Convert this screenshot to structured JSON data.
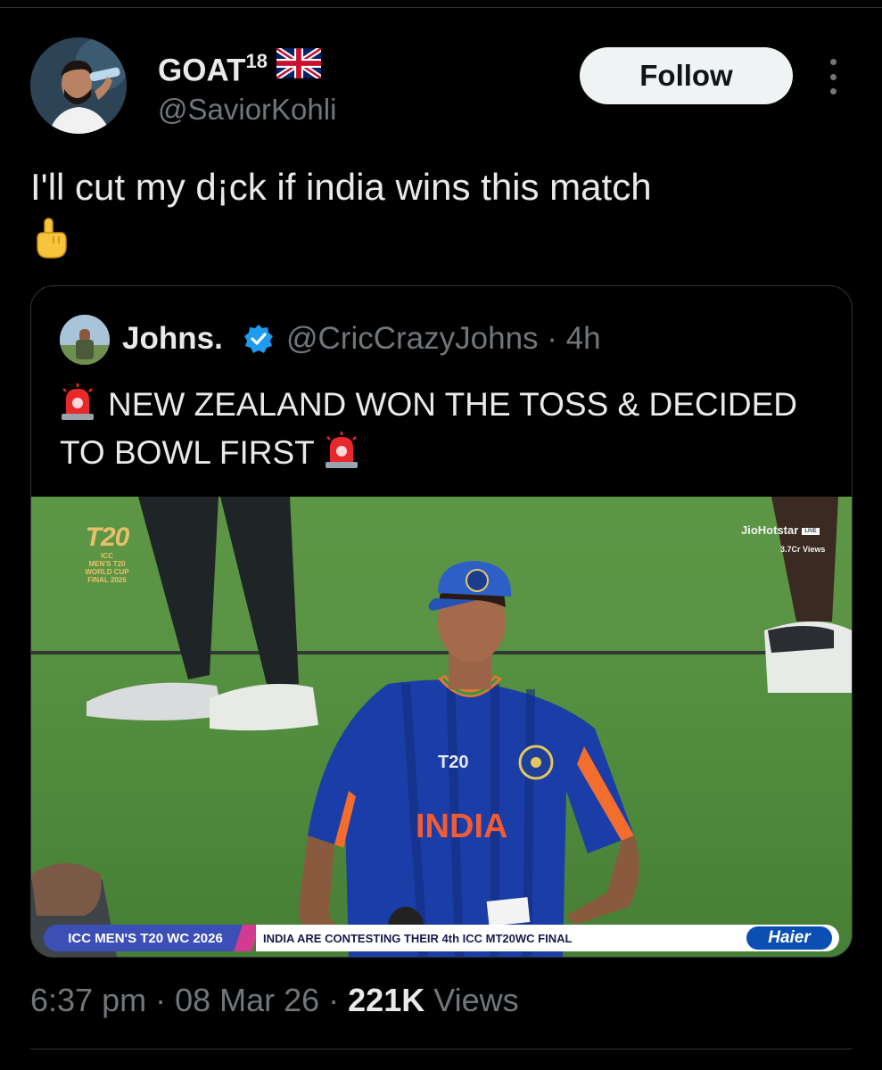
{
  "author": {
    "name": "GOAT",
    "name_superscript": "18",
    "handle": "@SaviorKohli"
  },
  "follow_label": "Follow",
  "tweet": {
    "text": "I'll cut my d¡ck if india wins this match"
  },
  "quote": {
    "name": "Johns.",
    "handle_time": "@CricCrazyJohns · 4h",
    "text": "NEW ZEALAND WON THE TOSS & DECIDED TO BOWL FIRST",
    "media": {
      "logo_number": "T20",
      "logo_lines": [
        "ICC",
        "MEN'S T20",
        "WORLD CUP",
        "FINAL 2026"
      ],
      "broadcaster": "JioHotstar",
      "live_tag": "LIVE",
      "views_overlay": "3.7Cr Views",
      "jersey_text": "INDIA",
      "ticker_left": "ICC MEN'S T20 WC 2026",
      "ticker_main": "INDIA ARE CONTESTING THEIR 4th ICC MT20WC FINAL",
      "sponsor": "Haier"
    }
  },
  "meta": {
    "time_date": "6:37 pm · 08 Mar 26 · ",
    "views_count": "221K",
    "views_label": " Views"
  },
  "colors": {
    "background": "#000000",
    "text": "#e7e9ea",
    "muted": "#71767b",
    "border": "#2f3336",
    "verified": "#1d9bf0"
  }
}
